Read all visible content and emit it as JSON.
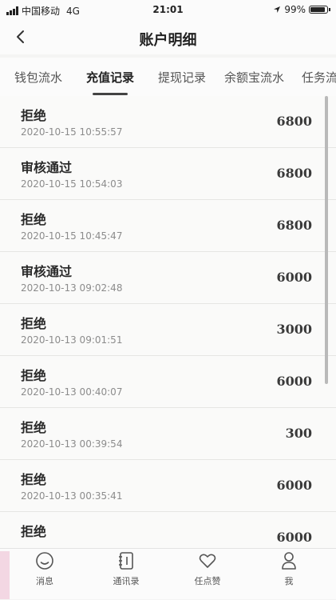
{
  "status_bar": {
    "carrier": "中国移动",
    "network": "4G",
    "time": "21:01",
    "battery": "99%",
    "battery_level": 0.99
  },
  "nav": {
    "back_icon": "chevron-left-icon",
    "title": "账户明细"
  },
  "tabs": [
    {
      "label": "钱包流水",
      "active": false
    },
    {
      "label": "充值记录",
      "active": true
    },
    {
      "label": "提现记录",
      "active": false
    },
    {
      "label": "余额宝流水",
      "active": false
    },
    {
      "label": "任务流",
      "active": false
    }
  ],
  "records": [
    {
      "status": "拒绝",
      "time": "2020-10-15 10:55:57",
      "amount": "6800"
    },
    {
      "status": "审核通过",
      "time": "2020-10-15 10:54:03",
      "amount": "6800"
    },
    {
      "status": "拒绝",
      "time": "2020-10-15 10:45:47",
      "amount": "6800"
    },
    {
      "status": "审核通过",
      "time": "2020-10-13 09:02:48",
      "amount": "6000"
    },
    {
      "status": "拒绝",
      "time": "2020-10-13 09:01:51",
      "amount": "3000"
    },
    {
      "status": "拒绝",
      "time": "2020-10-13 00:40:07",
      "amount": "6000"
    },
    {
      "status": "拒绝",
      "time": "2020-10-13 00:39:54",
      "amount": "300"
    },
    {
      "status": "拒绝",
      "time": "2020-10-13 00:35:41",
      "amount": "6000"
    },
    {
      "status": "拒绝",
      "time": "",
      "amount": "6000"
    }
  ],
  "tabbar": [
    {
      "label": "消息",
      "icon": "smiley-icon"
    },
    {
      "label": "通讯录",
      "icon": "contacts-book-icon"
    },
    {
      "label": "任点赞",
      "icon": "heart-icon"
    },
    {
      "label": "我",
      "icon": "user-icon"
    }
  ]
}
